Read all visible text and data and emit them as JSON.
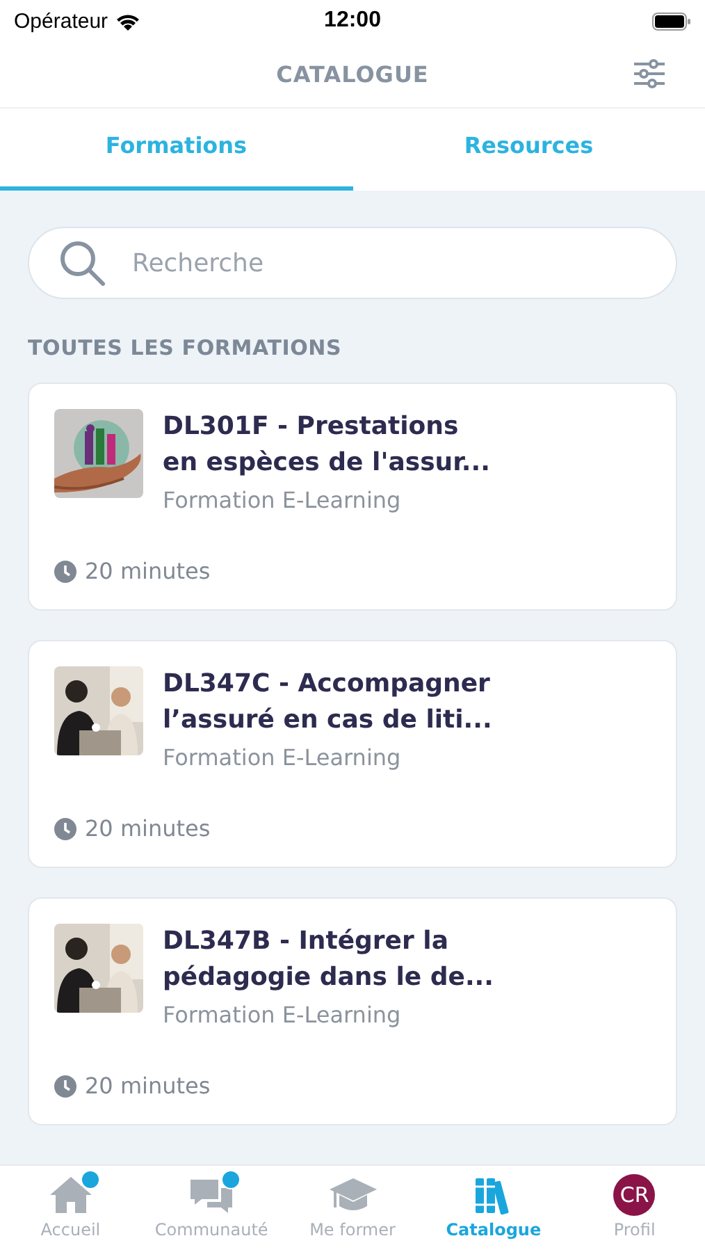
{
  "status_bar": {
    "carrier": "Opérateur",
    "time": "12:00"
  },
  "header": {
    "title": "CATALOGUE"
  },
  "tabs": [
    {
      "label": "Formations",
      "selected": true
    },
    {
      "label": "Resources",
      "selected": false
    }
  ],
  "search": {
    "placeholder": "Recherche"
  },
  "section_title": "TOUTES LES FORMATIONS",
  "courses": [
    {
      "title": "DL301F - Prestations en espèces de l'assur...",
      "type": "Formation E-Learning",
      "duration": "20 minutes"
    },
    {
      "title": "DL347C - Accompagner l’assuré en cas de liti...",
      "type": "Formation E-Learning",
      "duration": "20 minutes"
    },
    {
      "title": "DL347B - Intégrer la pédagogie dans le de...",
      "type": "Formation E-Learning",
      "duration": "20 minutes"
    }
  ],
  "bottom_nav": [
    {
      "kind": "home",
      "label": "Accueil",
      "badge": true,
      "selected": false
    },
    {
      "kind": "chat",
      "label": "Communauté",
      "badge": true,
      "selected": false
    },
    {
      "kind": "cap",
      "label": "Me former",
      "badge": false,
      "selected": false
    },
    {
      "kind": "books",
      "label": "Catalogue",
      "badge": false,
      "selected": true
    },
    {
      "kind": "avatar",
      "label": "Profil",
      "badge": false,
      "selected": false,
      "initials": "CR"
    }
  ]
}
